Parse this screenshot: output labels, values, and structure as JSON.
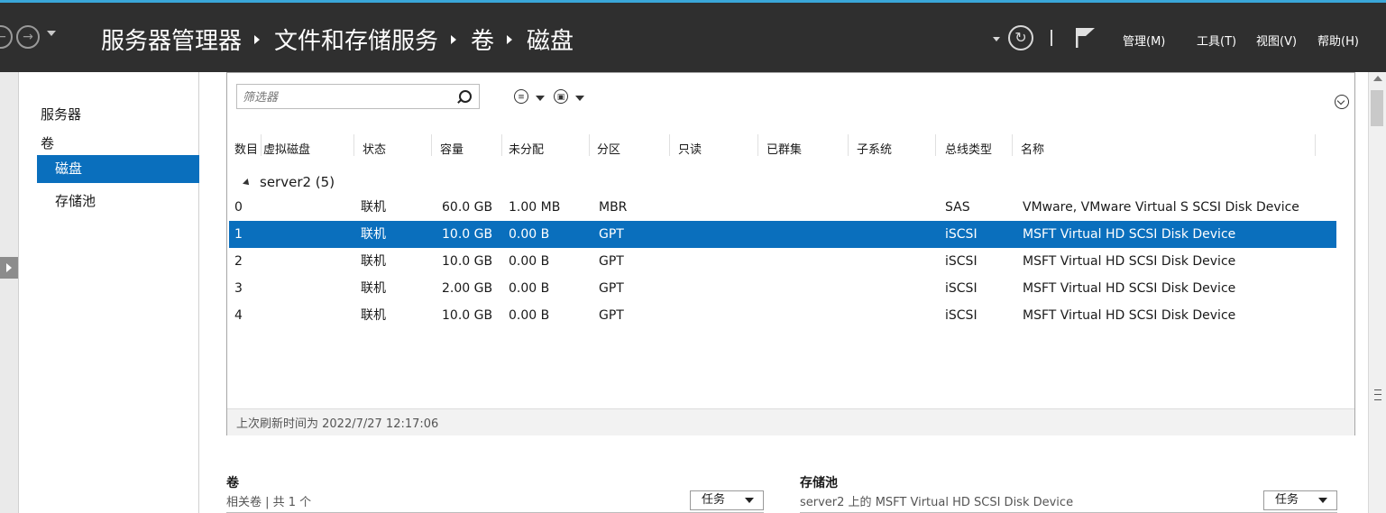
{
  "header": {
    "breadcrumb": [
      "服务器管理器",
      "文件和存储服务",
      "卷",
      "磁盘"
    ],
    "menus": [
      "管理(M)",
      "工具(T)",
      "视图(V)",
      "帮助(H)"
    ]
  },
  "sidebar": {
    "items": [
      {
        "label": "服务器",
        "selected": false
      },
      {
        "label": "卷",
        "selected": false
      },
      {
        "label": "磁盘",
        "selected": true
      },
      {
        "label": "存储池",
        "selected": false
      }
    ]
  },
  "disks": {
    "filter_placeholder": "筛选器",
    "columns": [
      "数目",
      "虚拟磁盘",
      "状态",
      "容量",
      "未分配",
      "分区",
      "只读",
      "已群集",
      "子系统",
      "总线类型",
      "名称"
    ],
    "group_label": "server2 (5)",
    "rows": [
      {
        "num": "0",
        "status": "联机",
        "capacity": "60.0 GB",
        "unalloc": "1.00 MB",
        "partition": "MBR",
        "bus": "SAS",
        "name": "VMware, VMware Virtual S SCSI Disk Device",
        "selected": false
      },
      {
        "num": "1",
        "status": "联机",
        "capacity": "10.0 GB",
        "unalloc": "0.00 B",
        "partition": "GPT",
        "bus": "iSCSI",
        "name": "MSFT Virtual HD SCSI Disk Device",
        "selected": true
      },
      {
        "num": "2",
        "status": "联机",
        "capacity": "10.0 GB",
        "unalloc": "0.00 B",
        "partition": "GPT",
        "bus": "iSCSI",
        "name": "MSFT Virtual HD SCSI Disk Device",
        "selected": false
      },
      {
        "num": "3",
        "status": "联机",
        "capacity": "2.00 GB",
        "unalloc": "0.00 B",
        "partition": "GPT",
        "bus": "iSCSI",
        "name": "MSFT Virtual HD SCSI Disk Device",
        "selected": false
      },
      {
        "num": "4",
        "status": "联机",
        "capacity": "10.0 GB",
        "unalloc": "0.00 B",
        "partition": "GPT",
        "bus": "iSCSI",
        "name": "MSFT Virtual HD SCSI Disk Device",
        "selected": false
      }
    ],
    "last_refresh": "上次刷新时间为 2022/7/27 12:17:06"
  },
  "volumes_section": {
    "title": "卷",
    "subtitle": "相关卷 | 共 1 个",
    "tasks_label": "任务"
  },
  "pool_section": {
    "title": "存储池",
    "subtitle": "server2 上的 MSFT Virtual HD SCSI Disk Device",
    "tasks_label": "任务"
  },
  "colors": {
    "header_bg": "#2f2f2f",
    "accent_line": "#3aa7d9",
    "selection": "#0a6fbd"
  }
}
